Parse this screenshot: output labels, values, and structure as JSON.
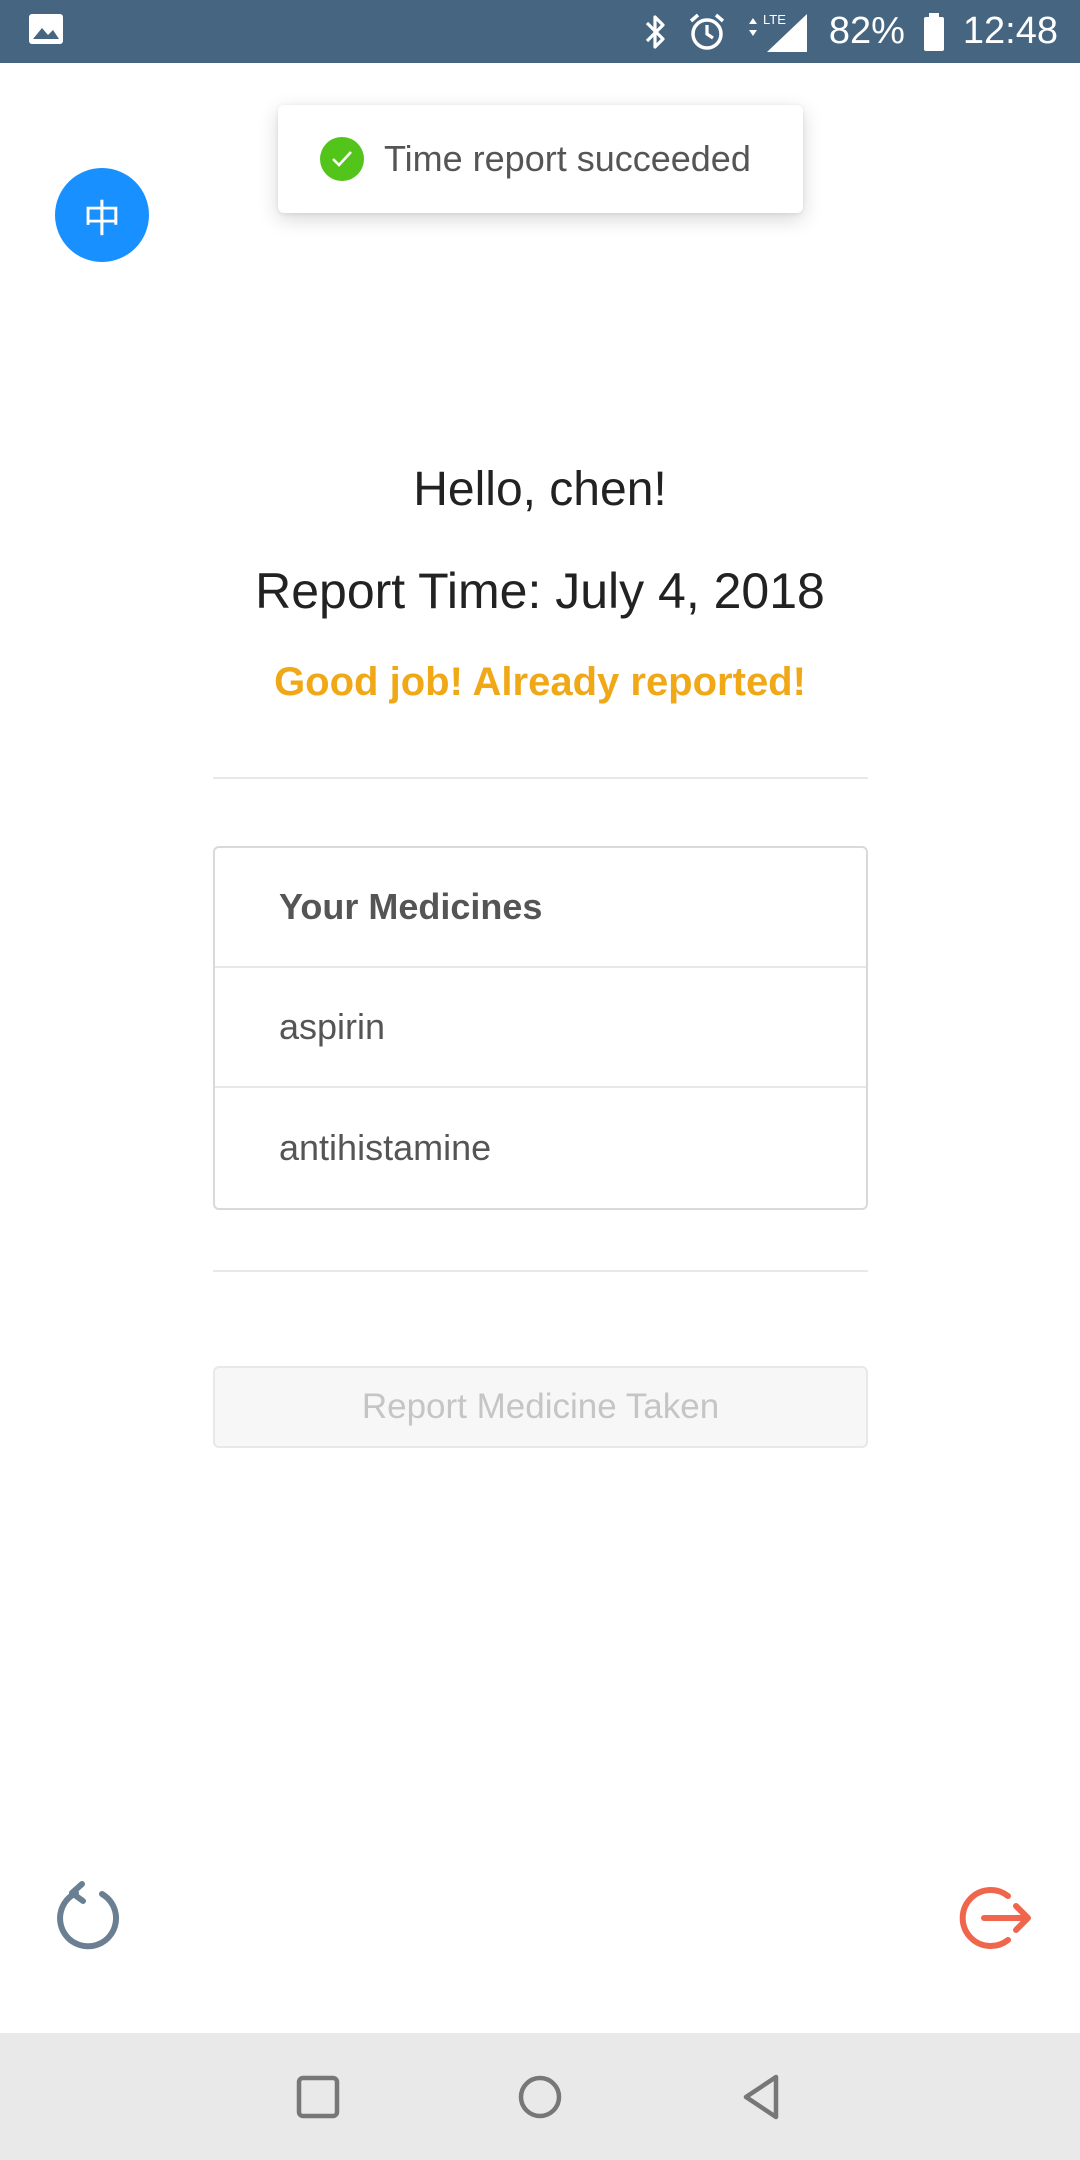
{
  "status_bar": {
    "battery": "82%",
    "time": "12:48",
    "network": "LTE",
    "icons": [
      "image-icon",
      "bluetooth-icon",
      "alarm-icon",
      "signal-icon",
      "battery-icon"
    ]
  },
  "toast": {
    "message": "Time report succeeded",
    "icon": "check-circle-icon",
    "color": "#52c41a"
  },
  "language_toggle": {
    "label": "中",
    "color": "#1890ff"
  },
  "main": {
    "greeting": "Hello, chen!",
    "report_time": "Report Time: July 4, 2018",
    "status_message": "Good job! Already reported!",
    "status_color": "#f0a817"
  },
  "medicines": {
    "header": "Your Medicines",
    "items": [
      "aspirin",
      "antihistamine"
    ]
  },
  "report_button": {
    "label": "Report Medicine Taken",
    "disabled": true
  },
  "bottom_actions": {
    "refresh_icon": "refresh-icon",
    "logout_icon": "logout-icon",
    "logout_color": "#f0664d"
  },
  "nav_bar": {
    "buttons": [
      "recent-apps-icon",
      "home-icon",
      "back-icon"
    ]
  }
}
